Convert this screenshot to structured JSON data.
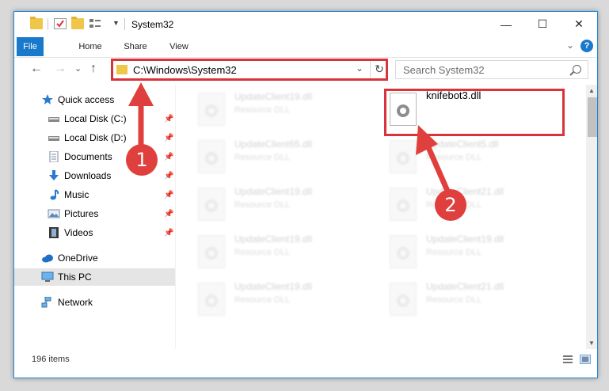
{
  "window": {
    "title": "System32"
  },
  "title_controls": {
    "minimize": "—",
    "maximize": "☐",
    "close": "✕"
  },
  "ribbon": {
    "tabs": [
      "File",
      "Home",
      "Share",
      "View"
    ],
    "expand": "⌄",
    "help": "?"
  },
  "nav": {
    "back": "←",
    "forward": "→",
    "recent": "⌄",
    "up": "↑",
    "address": "C:\\Windows\\System32",
    "address_dropdown": "⌄",
    "refresh": "↻",
    "search_placeholder": "Search System32"
  },
  "sidebar": {
    "items": [
      {
        "label": "Quick access",
        "icon": "star-icon",
        "pinned": false
      },
      {
        "label": "Local Disk (C:)",
        "icon": "drive-icon",
        "pinned": true
      },
      {
        "label": "Local Disk (D:)",
        "icon": "drive-icon",
        "pinned": true
      },
      {
        "label": "Documents",
        "icon": "documents-icon",
        "pinned": true
      },
      {
        "label": "Downloads",
        "icon": "download-icon",
        "pinned": true
      },
      {
        "label": "Music",
        "icon": "music-icon",
        "pinned": true
      },
      {
        "label": "Pictures",
        "icon": "pictures-icon",
        "pinned": true
      },
      {
        "label": "Videos",
        "icon": "videos-icon",
        "pinned": true
      },
      {
        "label": "OneDrive",
        "icon": "cloud-icon",
        "pinned": false
      },
      {
        "label": "This PC",
        "icon": "computer-icon",
        "pinned": false
      },
      {
        "label": "Network",
        "icon": "network-icon",
        "pinned": false
      }
    ],
    "pin_glyph": "📌"
  },
  "files": [
    {
      "name": "UpdateClient19.dll",
      "type": "Resource DLL"
    },
    {
      "name": "knifebot3.dll",
      "type": ""
    },
    {
      "name": "UpdateClient65.dll",
      "type": "Resource DLL"
    },
    {
      "name": "UpdateClient5.dll",
      "type": "Resource DLL"
    },
    {
      "name": "UpdateClient19.dll",
      "type": "Resource DLL"
    },
    {
      "name": "UpdateClient21.dll",
      "type": "Resource DLL"
    },
    {
      "name": "UpdateClient19.dll",
      "type": "Resource DLL"
    },
    {
      "name": "UpdateClient19.dll",
      "type": "Resource DLL"
    },
    {
      "name": "UpdateClient19.dll",
      "type": "Resource DLL"
    },
    {
      "name": "UpdateClient21.dll",
      "type": "Resource DLL"
    }
  ],
  "status": {
    "item_count": "196 items"
  },
  "annotations": {
    "step1": "1",
    "step2": "2",
    "color": "#e0403d"
  },
  "colors": {
    "accent": "#1979ca",
    "highlight_box": "#d9343b",
    "selected_bg": "#cce8ff"
  }
}
